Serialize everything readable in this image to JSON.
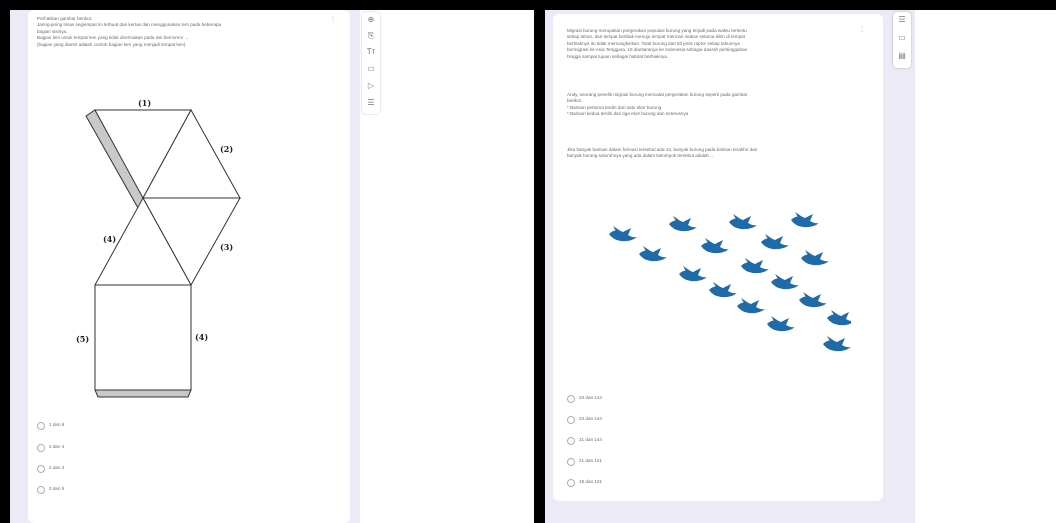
{
  "left_question": {
    "lines": [
      "Perhatikan gambar berikut.",
      "Jaring-jaring limas segiempat ini terbuat dari kertas dan menggunakan lem pada beberapa",
      "bagian sisinya.",
      "Bagian lem untuk tempat lem yang tidak dirermakan pada sisi bernomor ...",
      "(bagian yang diarsir adalah contoh bagian lem yang menjadi tempat lem)"
    ],
    "net_labels": {
      "t1": "(1)",
      "t2": "(2)",
      "t3": "(3)",
      "t4": "(4)",
      "sq_left": "(5)",
      "sq_right": "(4)"
    },
    "options": [
      "1 dan 6",
      "3 dan 4",
      "2 dan 4",
      "3 dan 5"
    ]
  },
  "right_question": {
    "paragraph1": [
      "Migrasi burung merupakan pergerakan populasi burung yang terjadi pada waktu tertentu",
      "setiap tahun, dari tempat berbiak menuju tempat mencari makan selama iklim di tempat",
      "berbiaknya itu tidak memungkinkan. Total burung dari 83 jenis raptor setiap tahunnya",
      "bermigrasi ke Asia Tenggara, 19 diantaranya ke Indonesia sebagai daerah persinggahan",
      "hingga sampai tujuan sebagai habitat berbiaknya."
    ],
    "paragraph2": [
      "Andy, seorang peneliti migrasi burung mencatat pergerakan burung seperti pada gambar",
      "berikut.",
      "* Barisan pertama terdiri dari satu ekor burung",
      "* Barisan kedua terdiri dari tiga ekor burung dan seterusnya"
    ],
    "paragraph3": [
      "Jika banyak barisan dalam formasi tersebut ada 12, banyak burung pada barisan terakhir dan",
      "banyak burung seluruhnya yang ada dalam kelompok tersebut adalah ..."
    ],
    "options": [
      "23 dan 144",
      "23 dan 144",
      "21 dan 144",
      "21 dan 121",
      "19 dan 121"
    ]
  },
  "toolbar_left": {
    "icons": [
      "add-question-icon",
      "import-questions-icon",
      "add-title-icon",
      "add-image-icon",
      "add-video-icon",
      "add-section-icon"
    ]
  },
  "toolbar_right": {
    "icons": [
      "add-title-icon",
      "add-image-icon",
      "add-section-icon"
    ]
  },
  "colors": {
    "bird": "#1f6aa8",
    "form_bg": "#eceaf6",
    "glue_tab": "#c9c9c9"
  }
}
